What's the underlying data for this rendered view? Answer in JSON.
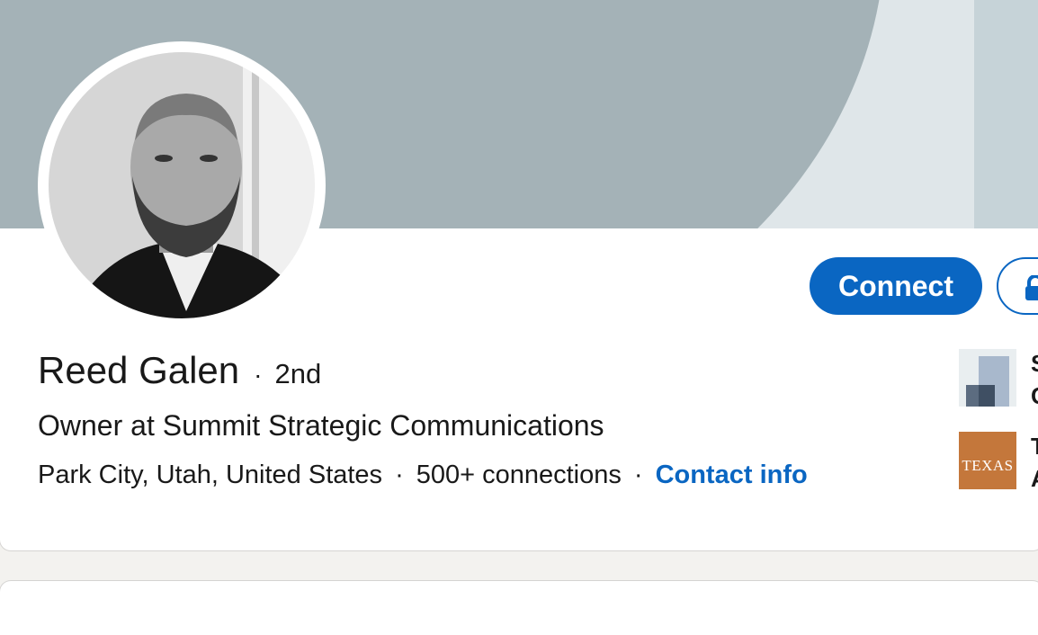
{
  "profile": {
    "name": "Reed Galen",
    "separator": "·",
    "degree": "2nd",
    "headline": "Owner at Summit Strategic Communications",
    "location": "Park City, Utah, United States",
    "connections": "500+ connections",
    "contact_info_label": "Contact info"
  },
  "actions": {
    "connect_label": "Connect",
    "lock_icon": "lock-icon"
  },
  "sidebar": {
    "items": [
      {
        "logo": "company-logo",
        "text_line1": "S",
        "text_line2": "C"
      },
      {
        "logo": "texas-logo",
        "logo_text": "TEXAS",
        "text_line1": "T",
        "text_line2": "A"
      }
    ]
  },
  "colors": {
    "brand_blue": "#0a66c2",
    "banner_gray": "#a4b2b7",
    "texas_orange": "#c4773b"
  }
}
